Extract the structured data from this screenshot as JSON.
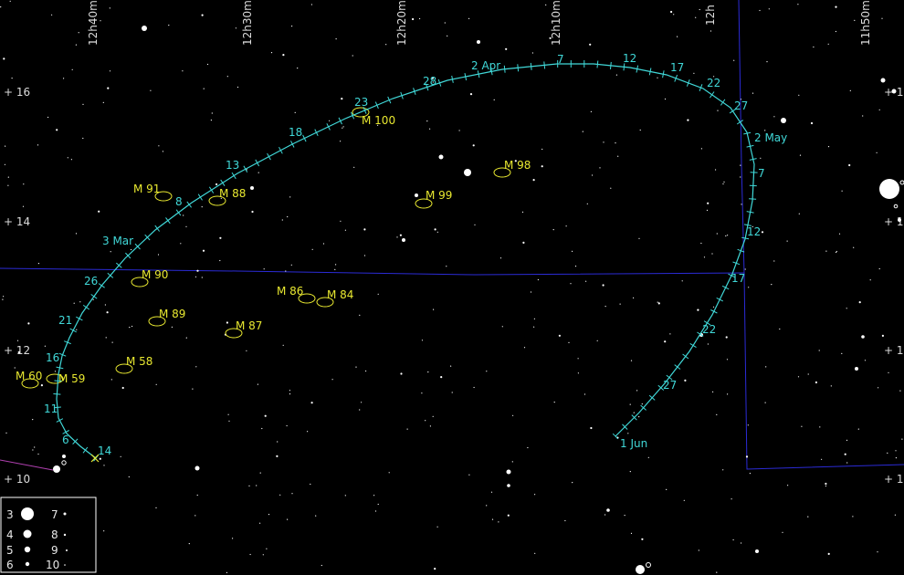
{
  "ra_labels": [
    "12h40m",
    "12h30m",
    "12h20m",
    "12h10m",
    "12h",
    "11h50m"
  ],
  "dec_labels": [
    "+ 16",
    "+ 14",
    "+ 12",
    "+ 10"
  ],
  "dates": [
    "14",
    "6",
    "11",
    "16",
    "21",
    "26",
    "3 Mar",
    "8",
    "13",
    "18",
    "23",
    "28",
    "2 Apr",
    "7",
    "12",
    "17",
    "22",
    "27",
    "2 May",
    "7",
    "12",
    "17",
    "22",
    "27",
    "1 Jun"
  ],
  "messier": [
    "M 100",
    "M 98",
    "M 99",
    "M 91",
    "M 88",
    "M 90",
    "M 86",
    "M 84",
    "M 89",
    "M 87",
    "M 58",
    "M 60",
    "M 59"
  ],
  "legend": [
    "3",
    "4",
    "5",
    "6",
    "7",
    "8",
    "9",
    "10"
  ],
  "colors": {
    "path": "#40d8d8",
    "messier": "#e8e830",
    "boundary": "#2b2bd6",
    "ecliptic": "#b040b0",
    "stars": "#ffffff",
    "labels": "#dcdcdc"
  }
}
